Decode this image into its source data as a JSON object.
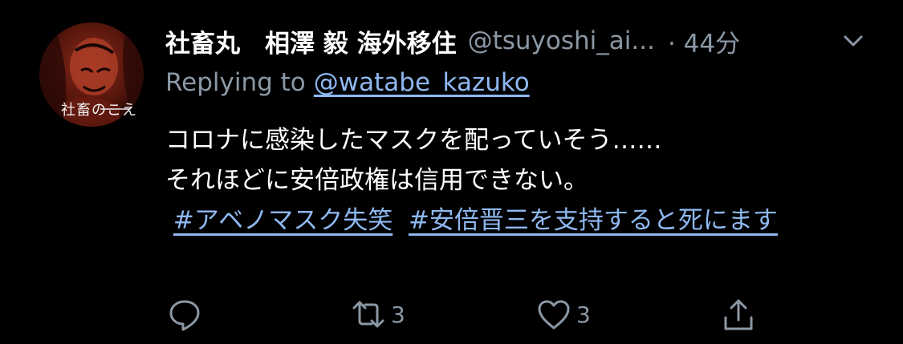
{
  "tweet": {
    "avatar_caption": "社畜のこえ",
    "display_name": "社畜丸　相澤 毅 海外移住",
    "handle": "@tsuyoshi_ai...",
    "time": "· 44分",
    "reply_prefix": "Replying to",
    "reply_to": "@watabe_kazuko",
    "body_lines": [
      "コロナに感染したマスクを配っていそう……",
      "それほどに安倍政権は信用できない。"
    ],
    "hashtags": [
      "#アベノマスク失笑",
      "#安倍晋三を支持すると死にます"
    ],
    "actions": {
      "reply_count": "",
      "retweet_count": "3",
      "like_count": "3"
    },
    "icons": {
      "more": "chevron-down-icon",
      "reply": "reply-bubble-icon",
      "retweet": "retweet-icon",
      "like": "heart-icon",
      "share": "share-icon"
    },
    "colors": {
      "background": "#000000",
      "text": "#ffffff",
      "muted": "#8b98a5",
      "link": "#8fb8f0"
    }
  }
}
